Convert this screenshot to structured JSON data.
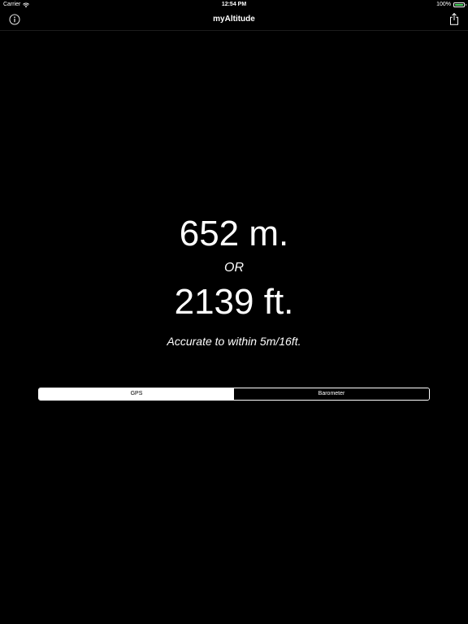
{
  "status_bar": {
    "carrier": "Carrier",
    "time": "12:54 PM",
    "battery": "100%",
    "wifi_icon": "wifi-icon",
    "battery_icon": "battery-icon",
    "battery_color": "#4cd964"
  },
  "nav": {
    "title": "myAltitude",
    "left_icon": "info-icon",
    "right_icon": "share-icon"
  },
  "readout": {
    "meters": "652 m.",
    "or": "OR",
    "feet": "2139 ft.",
    "accuracy": "Accurate to within 5m/16ft."
  },
  "segmented": {
    "segments": [
      {
        "label": "GPS",
        "selected": true
      },
      {
        "label": "Barometer",
        "selected": false
      }
    ]
  },
  "colors": {
    "background": "#000000",
    "foreground": "#ffffff"
  }
}
